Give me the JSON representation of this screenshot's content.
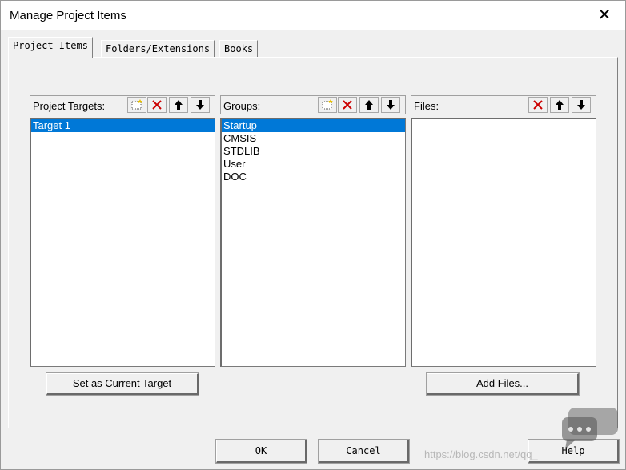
{
  "window": {
    "title": "Manage Project Items",
    "close_glyph": "✕"
  },
  "tabs": [
    {
      "label": "Project Items",
      "active": true
    },
    {
      "label": "Folders/Extensions",
      "active": false
    },
    {
      "label": "Books",
      "active": false
    }
  ],
  "targets_panel": {
    "label": "Project Targets:",
    "items": [
      {
        "label": "Target 1",
        "selected": true
      }
    ],
    "toolbar": [
      "new-icon",
      "delete-icon",
      "move-up-icon",
      "move-down-icon"
    ]
  },
  "groups_panel": {
    "label": "Groups:",
    "items": [
      {
        "label": "Startup",
        "selected": true
      },
      {
        "label": "CMSIS",
        "selected": false
      },
      {
        "label": "STDLIB",
        "selected": false
      },
      {
        "label": "User",
        "selected": false
      },
      {
        "label": "DOC",
        "selected": false
      }
    ],
    "toolbar": [
      "new-icon",
      "delete-icon",
      "move-up-icon",
      "move-down-icon"
    ]
  },
  "files_panel": {
    "label": "Files:",
    "items": [],
    "toolbar": [
      "delete-icon",
      "move-up-icon",
      "move-down-icon"
    ]
  },
  "buttons": {
    "set_current_target": "Set as Current Target",
    "add_files": "Add Files...",
    "ok": "OK",
    "cancel": "Cancel",
    "help": "Help"
  },
  "watermark": {
    "text": "https://blog.csdn.net/qq_"
  },
  "colors": {
    "selection": "#0078d7",
    "delete_red": "#cc0000",
    "dialog_bg": "#f0f0f0"
  }
}
